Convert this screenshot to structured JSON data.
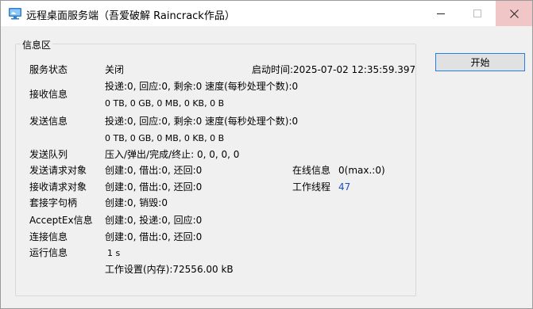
{
  "window": {
    "title": "远程桌面服务端（吾爱破解 Raincrack作品）"
  },
  "group": {
    "title": "信息区"
  },
  "rows": {
    "service_label": "服务状态",
    "service_value": "关闭",
    "start_time_label": "启动时间:",
    "start_time_value": "2025-07-02 12:35:59.397",
    "recv_label": "接收信息",
    "recv_line1": "投递:0, 回应:0, 剩余:0 速度(每秒处理个数):0",
    "recv_line2": "0 TB, 0 GB, 0 MB, 0 KB, 0 B",
    "send_label": "发送信息",
    "send_line1": "投递:0, 回应:0, 剩余:0 速度(每秒处理个数):0",
    "send_line2": "0 TB, 0 GB, 0 MB, 0 KB, 0 B",
    "send_queue_label": "发送队列",
    "send_queue_value": "压入/弹出/完成/终止: 0, 0, 0, 0",
    "send_req_label": "发送请求对象",
    "send_req_value": "创建:0, 借出:0, 还回:0",
    "online_label": "在线信息",
    "online_value": "0(max.:0)",
    "recv_req_label": "接收请求对象",
    "recv_req_value": "创建:0, 借出:0, 还回:0",
    "worker_label": "工作线程",
    "worker_value": "47",
    "socket_label": "套接字句柄",
    "socket_value": "创建:0, 销毁:0",
    "acceptex_label": "AcceptEx信息",
    "acceptex_value": "创建:0, 投递:0, 回应:0",
    "conn_label": "连接信息",
    "conn_value": "创建:0, 借出:0, 还回:0",
    "run_label": "运行信息",
    "run_value": "1 s",
    "mem_value": "工作设置(内存):72556.00 kB"
  },
  "buttons": {
    "start": "开始"
  },
  "icons": {
    "app": "remote-desktop-cloud-icon",
    "minimize": "minimize-icon",
    "maximize": "maximize-icon",
    "close": "close-icon"
  }
}
